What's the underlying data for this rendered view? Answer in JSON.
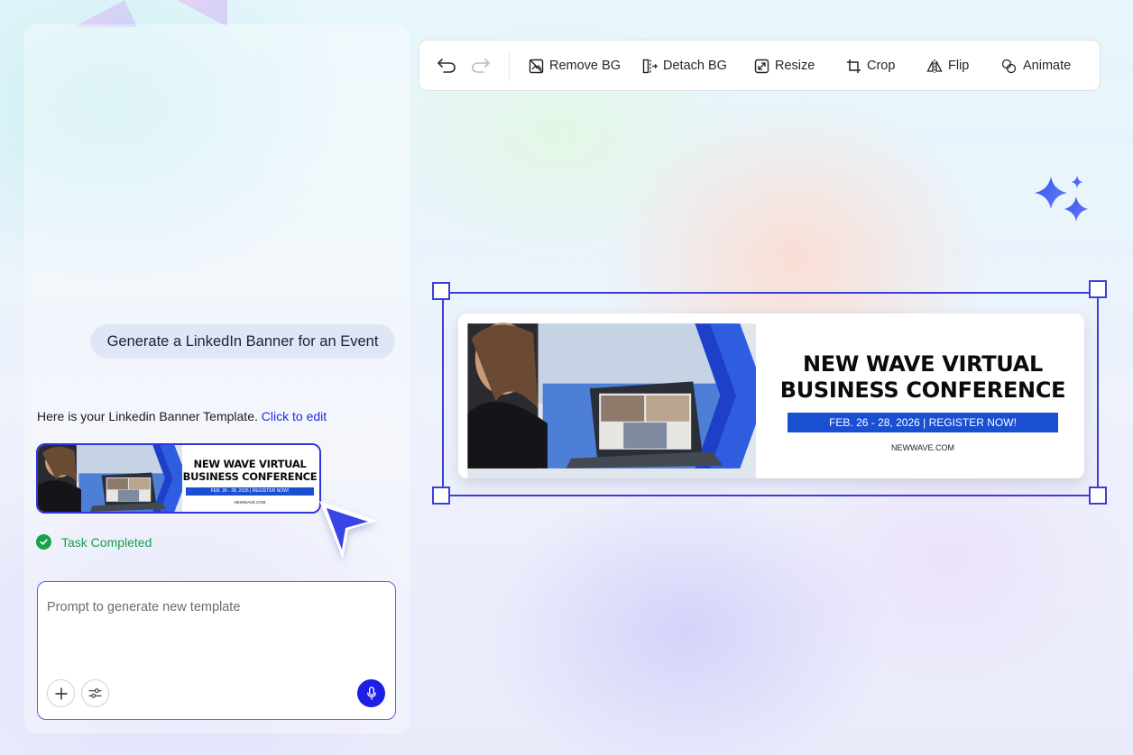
{
  "chat": {
    "user_message": "Generate a LinkedIn Banner for an Event",
    "bot_message_prefix": "Here is your Linkedin Banner Template.",
    "bot_message_link": "Click to edit",
    "task_status": "Task Completed",
    "prompt_placeholder": "Prompt to generate new template"
  },
  "toolbar": {
    "remove_bg": "Remove BG",
    "detach_bg": "Detach BG",
    "resize": "Resize",
    "crop": "Crop",
    "flip": "Flip",
    "animate": "Animate"
  },
  "banner": {
    "title_line1": "NEW WAVE VIRTUAL",
    "title_line2": "BUSINESS CONFERENCE",
    "strip_text": "FEB. 26 - 28, 2026   |   REGISTER NOW!",
    "thumb_strip_text": "FEB. 26 - 28, 2026   |   REGISTER NOW!",
    "website": "NEWWAVE.COM"
  },
  "colors": {
    "accent": "#1c1fe6",
    "selection": "#3b3fd8",
    "banner_blue": "#1a4fd2",
    "success": "#17a24a"
  }
}
